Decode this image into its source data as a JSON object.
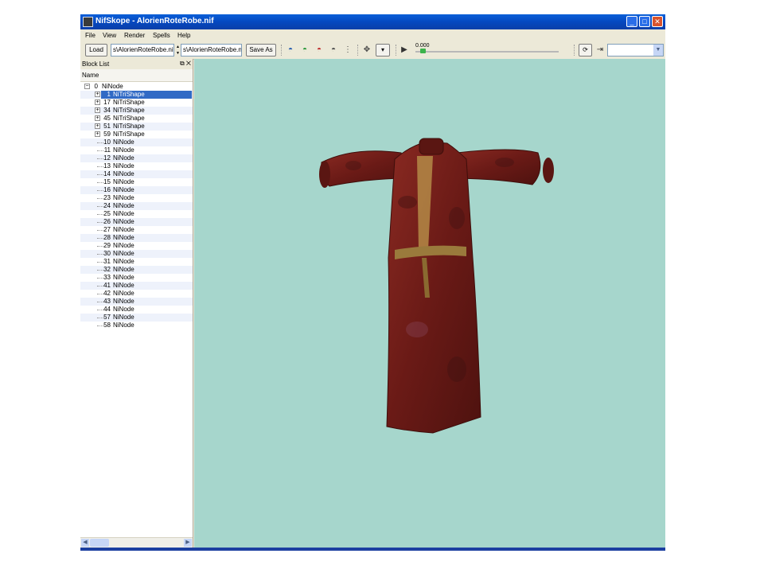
{
  "window": {
    "title": "NifSkope - AlorienRoteRobe.nif",
    "controls": {
      "minimize": "_",
      "maximize": "□",
      "close": "✕"
    }
  },
  "menu": [
    "File",
    "View",
    "Render",
    "Spells",
    "Help"
  ],
  "toolbar": {
    "load_label": "Load",
    "load_path": "s\\AlorienRoteRobe.nif",
    "save_path": "s\\AlorienRoteRobe.nif",
    "save_as_label": "Save As",
    "time_value": "0.000",
    "timeline_position": 0.0,
    "accent_color": "#3bb34a"
  },
  "block_list": {
    "title": "Block List",
    "column_name": "Name",
    "rows": [
      {
        "num": "0",
        "name": "NiNode",
        "expander": "⊟",
        "level": 0
      },
      {
        "num": "1",
        "name": "NiTriShape",
        "expander": "⊞",
        "level": 1,
        "selected": true
      },
      {
        "num": "17",
        "name": "NiTriShape",
        "expander": "⊞",
        "level": 1
      },
      {
        "num": "34",
        "name": "NiTriShape",
        "expander": "⊞",
        "level": 1
      },
      {
        "num": "45",
        "name": "NiTriShape",
        "expander": "⊞",
        "level": 1
      },
      {
        "num": "51",
        "name": "NiTriShape",
        "expander": "⊞",
        "level": 1
      },
      {
        "num": "59",
        "name": "NiTriShape",
        "expander": "⊞",
        "level": 1
      },
      {
        "num": "10",
        "name": "NiNode",
        "level": 1
      },
      {
        "num": "11",
        "name": "NiNode",
        "level": 1
      },
      {
        "num": "12",
        "name": "NiNode",
        "level": 1
      },
      {
        "num": "13",
        "name": "NiNode",
        "level": 1
      },
      {
        "num": "14",
        "name": "NiNode",
        "level": 1
      },
      {
        "num": "15",
        "name": "NiNode",
        "level": 1
      },
      {
        "num": "16",
        "name": "NiNode",
        "level": 1
      },
      {
        "num": "23",
        "name": "NiNode",
        "level": 1
      },
      {
        "num": "24",
        "name": "NiNode",
        "level": 1
      },
      {
        "num": "25",
        "name": "NiNode",
        "level": 1
      },
      {
        "num": "26",
        "name": "NiNode",
        "level": 1
      },
      {
        "num": "27",
        "name": "NiNode",
        "level": 1
      },
      {
        "num": "28",
        "name": "NiNode",
        "level": 1
      },
      {
        "num": "29",
        "name": "NiNode",
        "level": 1
      },
      {
        "num": "30",
        "name": "NiNode",
        "level": 1
      },
      {
        "num": "31",
        "name": "NiNode",
        "level": 1
      },
      {
        "num": "32",
        "name": "NiNode",
        "level": 1
      },
      {
        "num": "33",
        "name": "NiNode",
        "level": 1
      },
      {
        "num": "41",
        "name": "NiNode",
        "level": 1
      },
      {
        "num": "42",
        "name": "NiNode",
        "level": 1
      },
      {
        "num": "43",
        "name": "NiNode",
        "level": 1
      },
      {
        "num": "44",
        "name": "NiNode",
        "level": 1
      },
      {
        "num": "57",
        "name": "NiNode",
        "level": 1
      },
      {
        "num": "58",
        "name": "NiNode",
        "level": 1
      }
    ]
  },
  "viewport": {
    "background": "#a6d6cc",
    "robe_color": "#7a1f1a"
  }
}
